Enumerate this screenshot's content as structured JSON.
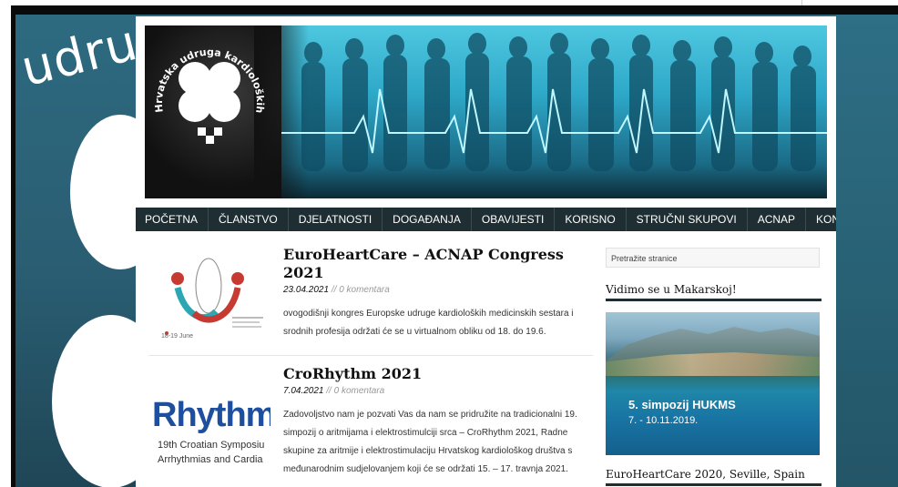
{
  "background": {
    "word": "udrug"
  },
  "banner": {
    "logo_ring_text": "Hrvatska udruga kardioloških medicinskih sestara"
  },
  "nav": {
    "items": [
      "POČETNA",
      "ČLANSTVO",
      "DJELATNOSTI",
      "DOGAĐANJA",
      "OBAVIJESTI",
      "KORISNO",
      "STRUČNI SKUPOVI",
      "ACNAP",
      "KONTAKT"
    ]
  },
  "posts": [
    {
      "title": "EuroHeartCare – ACNAP Congress 2021",
      "date": "23.04.2021",
      "separator": "//",
      "comments": "0 komentara",
      "excerpt": "ovogodišnji kongres Europske udruge kardioloških medicinskih sestara i srodnih profesija održati će se u virtualnom obliku od 18. do 19.6.",
      "thumb_caption": "18-19 June"
    },
    {
      "title": "CroRhythm 2021",
      "date": "7.04.2021",
      "separator": "//",
      "comments": "0 komentara",
      "excerpt": "Zadovoljstvo nam je pozvati Vas da nam se pridružite na tradicionalni 19. simpozij o aritmijama i elektrostimulciji srca – CroRhythm 2021, Radne skupine za aritmije i elektrostimulaciju Hrvatskog kardiološkog društva s međunarodnim sudjelovanjem koji će se održati 15. – 17. travnja 2021.",
      "thumb_word": "Rhythm",
      "thumb_line1": "19th Croatian Symposiu",
      "thumb_line2": "Arrhythmias and Cardia"
    }
  ],
  "sidebar": {
    "search_placeholder": "Pretražite stranice",
    "widget1_title": "Vidimo se u Makarskoj!",
    "promo_line1": "5. simpozij HUKMS",
    "promo_line2": "7. - 10.11.2019.",
    "widget2_title": "EuroHeartCare 2020, Seville, Spain"
  },
  "colors": {
    "nav_bg": "#1e2e33",
    "background": "#2d6a80",
    "banner_cyan": "#4ec7e0"
  }
}
